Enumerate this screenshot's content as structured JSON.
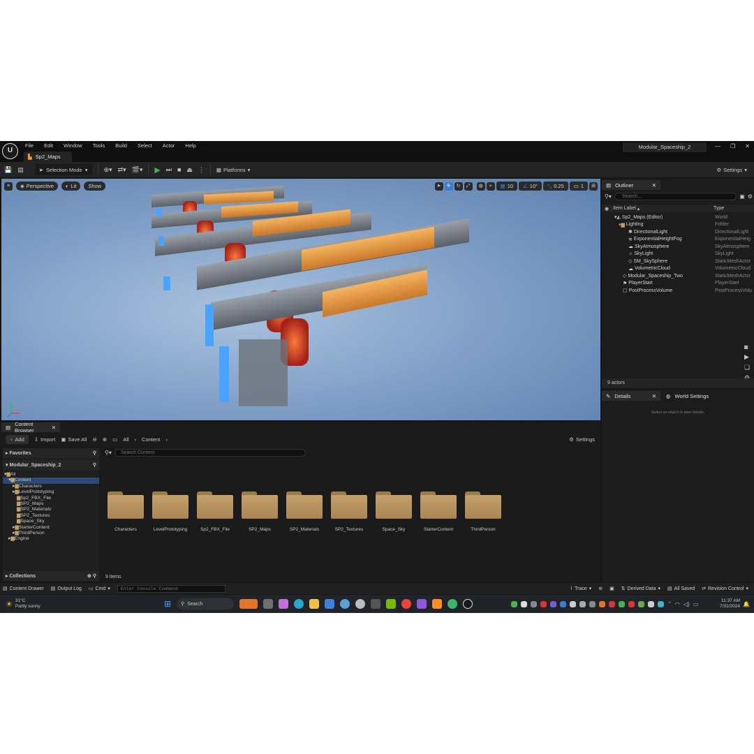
{
  "titlebar": {
    "menu": [
      "File",
      "Edit",
      "Window",
      "Tools",
      "Build",
      "Select",
      "Actor",
      "Help"
    ],
    "project_name": "Modular_Spaceship_2",
    "doc_tab": "Sp2_Maps"
  },
  "toolbar": {
    "selection_mode": "Selection Mode",
    "platforms": "Platforms",
    "settings": "Settings"
  },
  "viewport": {
    "perspective": "Perspective",
    "lit": "Lit",
    "show": "Show",
    "grid_snap": "10",
    "rotation_snap": "10°",
    "scale_snap": "0.25",
    "camera_speed": "1"
  },
  "outliner": {
    "tab": "Outliner",
    "search_placeholder": "Search...",
    "col_label": "Item Label",
    "col_type": "Type",
    "rows": [
      {
        "label": "Sp2_Maps (Editor)",
        "type": "World"
      },
      {
        "label": "Lighting",
        "type": "Folder"
      },
      {
        "label": "DirectionalLight",
        "type": "DirectionalLight"
      },
      {
        "label": "ExponentialHeightFog",
        "type": "ExponentialHeig"
      },
      {
        "label": "SkyAtmosphere",
        "type": "SkyAtmosphere"
      },
      {
        "label": "SkyLight",
        "type": "SkyLight"
      },
      {
        "label": "SM_SkySphere",
        "type": "StaticMeshActor"
      },
      {
        "label": "VolumetricCloud",
        "type": "VolumetricCloud"
      },
      {
        "label": "Modular_Spaceship_Two",
        "type": "StaticMeshActor"
      },
      {
        "label": "PlayerStart",
        "type": "PlayerStart"
      },
      {
        "label": "PostProcessVolume",
        "type": "PostProcessVolu"
      }
    ],
    "actor_count": "9 actors"
  },
  "details": {
    "tab": "Details",
    "world_settings": "World Settings",
    "empty_hint": "Select an object to view details."
  },
  "content_browser": {
    "tab": "Content Browser",
    "add": "Add",
    "import": "Import",
    "save_all": "Save All",
    "crumb_all": "All",
    "crumb_content": "Content",
    "settings": "Settings",
    "favorites": "Favorites",
    "project": "Modular_Spaceship_2",
    "search_placeholder": "Search Content",
    "tree": [
      "All",
      "Content",
      "Characters",
      "LevelPrototyping",
      "Sp2_FBX_File",
      "SP2_Maps",
      "SP2_Materials",
      "SP2_Textures",
      "Space_Sky",
      "StarterContent",
      "ThirdPerson",
      "Engine"
    ],
    "folders": [
      "Characters",
      "LevelPrototyping",
      "Sp2_FBX_File",
      "SP2_Maps",
      "SP2_Materials",
      "SP2_Textures",
      "Space_Sky",
      "StarterContent",
      "ThirdPerson"
    ],
    "item_count": "9 items",
    "collections": "Collections"
  },
  "bottombar": {
    "content_drawer": "Content Drawer",
    "output_log": "Output Log",
    "cmd": "Cmd",
    "console_placeholder": "Enter Console Command",
    "trace": "Trace",
    "derived_data": "Derived Data",
    "all_saved": "All Saved",
    "revision_control": "Revision Control"
  },
  "taskbar": {
    "temp": "31°C",
    "weather": "Partly sunny",
    "search": "Search",
    "time": "11:37 AM",
    "date": "7/31/2024"
  },
  "colors": {
    "accent_blue": "#3a7bd5",
    "play_green": "#4caf50",
    "folder": "#c4a06a",
    "ship_orange": "#e59a3c",
    "ship_glow": "#ff5a2a",
    "ship_blue": "#4aa3ff"
  }
}
